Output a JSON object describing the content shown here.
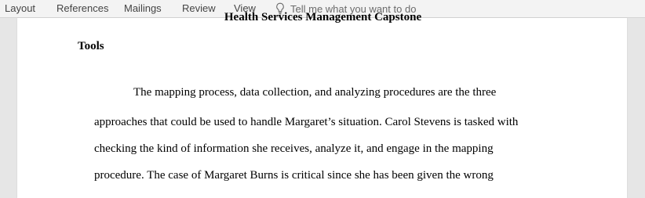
{
  "ribbon": {
    "tabs": [
      {
        "label": "Layout"
      },
      {
        "label": "References"
      },
      {
        "label": "Mailings"
      },
      {
        "label": "Review"
      },
      {
        "label": "View"
      }
    ],
    "tell_me": "Tell me what you want to do"
  },
  "document": {
    "title": "Health Services Management Capstone",
    "heading": "Tools",
    "lines": [
      "The mapping process, data collection, and analyzing procedures are the three",
      "approaches that could be used to handle Margaret’s situation. Carol Stevens is tasked with",
      "checking the kind of information she receives, analyze it, and engage in the mapping",
      "procedure. The case of Margaret Burns is critical since she has been given the wrong"
    ]
  }
}
